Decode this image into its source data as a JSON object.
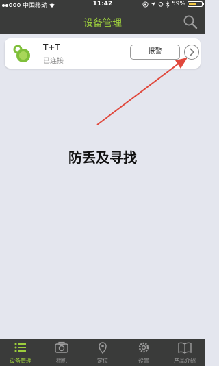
{
  "status_bar": {
    "carrier": "中国移动",
    "time": "11:42",
    "battery": "59%",
    "battery_level": 0.59
  },
  "nav": {
    "title": "设备管理"
  },
  "device": {
    "name": "T+T",
    "status": "已连接",
    "alarm_label": "报警"
  },
  "annotation": {
    "text": "防丢及寻找",
    "color": "#e0483c"
  },
  "tabs": [
    {
      "label": "设备管理",
      "icon": "list-icon",
      "active": true
    },
    {
      "label": "相机",
      "icon": "camera-icon",
      "active": false
    },
    {
      "label": "定位",
      "icon": "location-pin-icon",
      "active": false
    },
    {
      "label": "设置",
      "icon": "gear-icon",
      "active": false
    },
    {
      "label": "产品介绍",
      "icon": "book-icon",
      "active": false
    }
  ],
  "colors": {
    "accent": "#9cce3c",
    "bar": "#3a3b3a",
    "background": "#e4e6ee"
  }
}
